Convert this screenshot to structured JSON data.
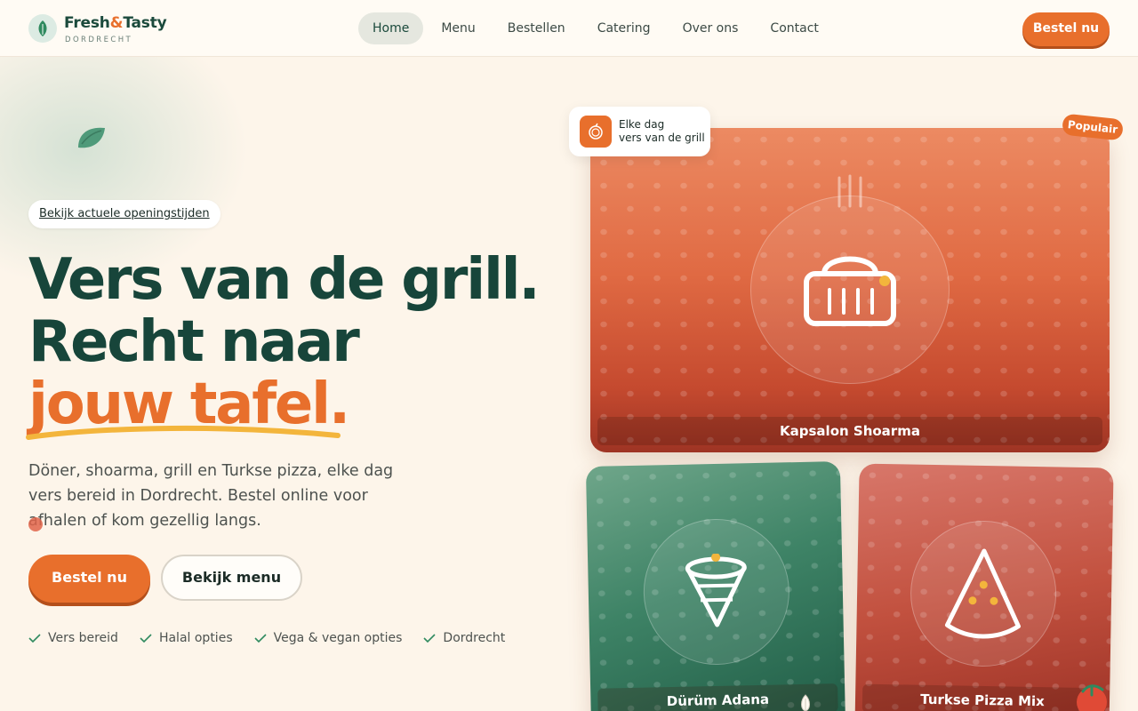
{
  "brand": {
    "name_part1": "Fresh",
    "name_amp": "&",
    "name_part2": "Tasty",
    "city": "DORDRECHT"
  },
  "nav": {
    "items": [
      "Home",
      "Menu",
      "Bestellen",
      "Catering",
      "Over ons",
      "Contact"
    ],
    "active": "Home",
    "cta": "Bestel nu"
  },
  "hero": {
    "hours_link": "Bekijk actuele openingstijden",
    "headline_line1": "Vers van de grill.",
    "headline_line2": "Recht naar",
    "headline_line3": "jouw tafel.",
    "lead": "Döner, shoarma, grill en Turkse pizza, elke dag vers bereid in Dordrecht. Bestel online voor afhalen of kom gezellig langs.",
    "primary_cta": "Bestel nu",
    "secondary_cta": "Bekijk menu",
    "features": [
      "Vers bereid",
      "Halal opties",
      "Vega & vegan opties",
      "Dordrecht"
    ]
  },
  "showcase": {
    "fresh_badge_line1": "Elke dag",
    "fresh_badge_line2": "vers van de grill",
    "popular_tag": "Populair",
    "cards": [
      {
        "name": "Kapsalon Shoarma",
        "icon": "basket-icon"
      },
      {
        "name": "Dürüm Adana",
        "icon": "wrap-icon"
      },
      {
        "name": "Turkse Pizza Mix",
        "icon": "pizza-slice-icon"
      }
    ]
  },
  "colors": {
    "brand_green": "#17453a",
    "accent_orange": "#e86f2c",
    "background": "#fdf5ea",
    "underline_yellow": "#f3b53c"
  }
}
